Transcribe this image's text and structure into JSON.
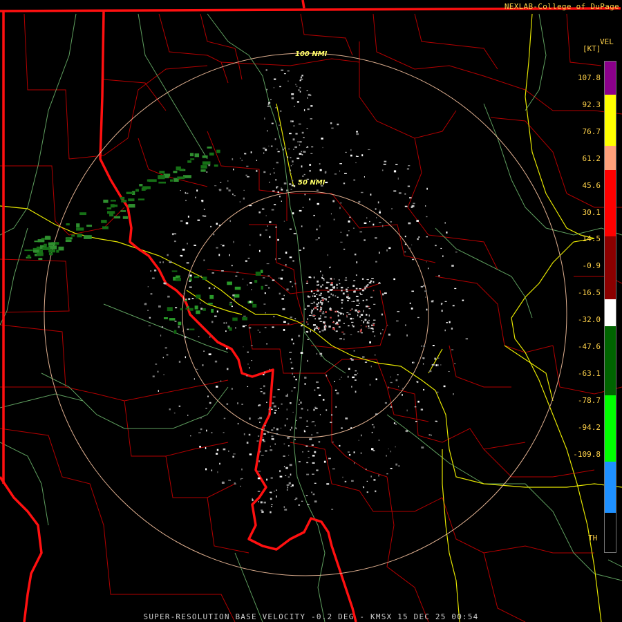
{
  "credit": "NEXLAB-College of DuPage",
  "footer": "SUPER-RESOLUTION BASE VELOCITY -0.2 DEG - KMSX 15 DEC 25 00:54",
  "range_rings": [
    {
      "label": "100 NMI"
    },
    {
      "label": "50 NMI"
    }
  ],
  "colorscale": {
    "product": "VEL",
    "unit": "[KT]",
    "ticks": [
      "107.8",
      "92.3",
      "76.7",
      "61.2",
      "45.6",
      "30.1",
      "14.5",
      "-0.9",
      "-16.5",
      "-32.0",
      "-47.6",
      "-63.1",
      "-78.7",
      "-94.2",
      "-109.8"
    ],
    "bottom_label": "TH",
    "bands": [
      "#8b008b",
      "#ffff00",
      "#ffa07a",
      "#ff0000",
      "#8b0000",
      "#ffffff",
      "#006400",
      "#00ff00",
      "#1e90ff",
      "#000000"
    ]
  },
  "colors": {
    "state_border": "#ff0000",
    "county_border": "#b40000",
    "rivers": "#5f9f5f",
    "highways": "#e6e600",
    "range_rings": "#e0b090"
  }
}
